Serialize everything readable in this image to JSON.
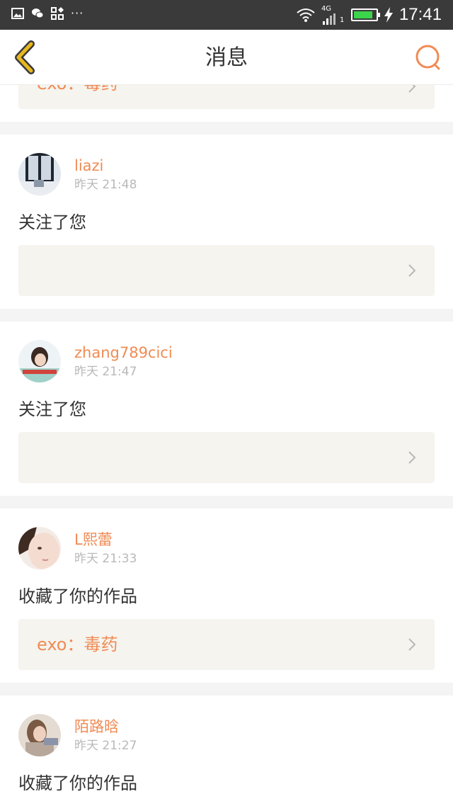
{
  "status_bar": {
    "dots": "···",
    "network": "4G",
    "sim_slot": "1",
    "battery_level": 0.76,
    "time": "17:41"
  },
  "header": {
    "title": "消息"
  },
  "colors": {
    "accent": "#f08b54",
    "back_icon": "#e8b820",
    "ref_bg": "#f5f4ef",
    "gap_bg": "#f4f4f4"
  },
  "top_partial": {
    "ref_text": "exo：毒药"
  },
  "messages": [
    {
      "user": "liazi",
      "time": "昨天 21:48",
      "action": "关注了您",
      "ref_text": ""
    },
    {
      "user": "zhang789cici",
      "time": "昨天 21:47",
      "action": "关注了您",
      "ref_text": ""
    },
    {
      "user": "L熙蕾",
      "time": "昨天 21:33",
      "action": "收藏了你的作品",
      "ref_text": "exo：毒药"
    },
    {
      "user": "陌路晗",
      "time": "昨天 21:27",
      "action": "收藏了你的作品",
      "ref_text": ""
    }
  ]
}
